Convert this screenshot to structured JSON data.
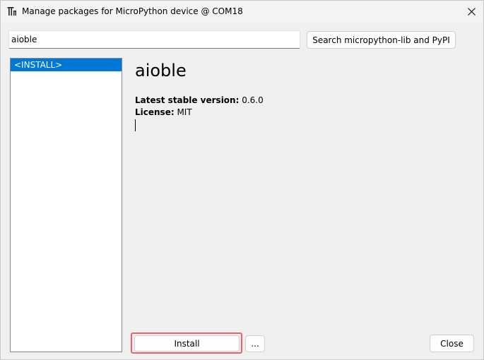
{
  "window": {
    "title": "Manage packages for MicroPython device @ COM18",
    "app_icon": "thonny-icon",
    "close_icon": "close-icon"
  },
  "search": {
    "value": "aioble",
    "button_label": "Search micropython-lib and PyPI"
  },
  "package_list": {
    "items": [
      {
        "label": "<INSTALL>",
        "selected": true
      }
    ]
  },
  "details": {
    "name": "aioble",
    "version_label": "Latest stable version:",
    "version_value": " 0.6.0",
    "license_label": "License:",
    "license_value": " MIT"
  },
  "buttons": {
    "install": "Install",
    "more": "...",
    "close": "Close"
  },
  "colors": {
    "selection": "#0078d7",
    "highlight_border": "#e8636e"
  }
}
